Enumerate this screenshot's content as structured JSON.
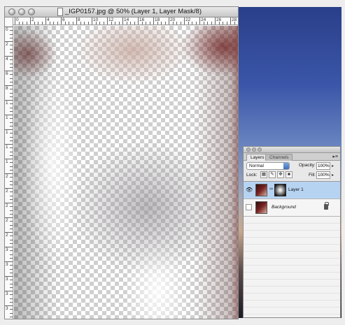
{
  "document": {
    "title": "_IGP0157.jpg @ 50% (Layer 1, Layer Mask/8)",
    "ruler_top_labels": [
      "0",
      "2",
      "4",
      "6",
      "8",
      "10",
      "12",
      "14",
      "16",
      "18",
      "20",
      "22",
      "24",
      "26",
      "28"
    ],
    "ruler_left_labels": [
      "0",
      "2",
      "4",
      "6",
      "8",
      "10",
      "12",
      "14",
      "16",
      "18",
      "20",
      "22",
      "24",
      "26",
      "28",
      "30",
      "32",
      "34",
      "36",
      "38",
      "40"
    ]
  },
  "palette": {
    "tabs": [
      "Layers",
      "Channels"
    ],
    "blend_mode": "Normal",
    "opacity_label": "Opacity:",
    "opacity_value": "100%",
    "lock_label": "Lock:",
    "fill_label": "Fill:",
    "fill_value": "100%",
    "layers": [
      {
        "name": "Layer 1",
        "visible": true,
        "selected": true,
        "has_mask": true
      },
      {
        "name": "Background",
        "visible": false,
        "selected": false,
        "locked": true
      }
    ]
  },
  "colors": {
    "selected_layer": "#b7d3f2",
    "desktop_top": "#2a3f8a",
    "desktop_bottom": "#1b1b22"
  }
}
